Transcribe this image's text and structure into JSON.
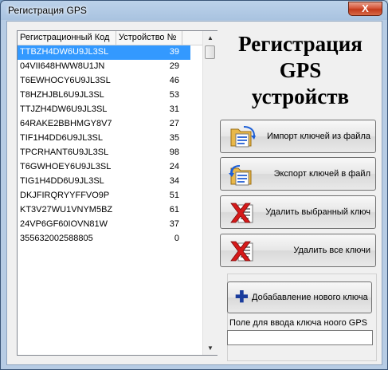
{
  "window": {
    "title": "Регистрация GPS",
    "close_label": "X"
  },
  "table": {
    "columns": [
      "Регистрационный Код",
      "Устройство №"
    ],
    "rows": [
      {
        "code": "TTBZH4DW6U9JL3SL",
        "device": "39",
        "selected": true
      },
      {
        "code": "04VII648HWW8U1JN",
        "device": "29"
      },
      {
        "code": "T6EWHOCY6U9JL3SL",
        "device": "46"
      },
      {
        "code": "T8HZHJBL6U9JL3SL",
        "device": "53"
      },
      {
        "code": "TTJZH4DW6U9JL3SL",
        "device": "31"
      },
      {
        "code": "64RAKE2BBHMGY8V7",
        "device": "27"
      },
      {
        "code": "TIF1H4DD6U9JL3SL",
        "device": "35"
      },
      {
        "code": "TPCRHANT6U9JL3SL",
        "device": "98"
      },
      {
        "code": "T6GWHOEY6U9JL3SL",
        "device": "24"
      },
      {
        "code": "TIG1H4DD6U9JL3SL",
        "device": "34"
      },
      {
        "code": "DKJFIRQRYYFFVO9P",
        "device": "51"
      },
      {
        "code": "KT3V27WU1VNYM5BZ",
        "device": "61"
      },
      {
        "code": "24VP6GF60IOVN81W",
        "device": "37"
      },
      {
        "code": "355632002588805",
        "device": "0"
      }
    ]
  },
  "heading": {
    "line1": "Регистрация",
    "line2": "GPS",
    "line3": "устройств"
  },
  "buttons": {
    "import": "Импорт ключей из файла",
    "export": "Экспорт ключей в файл",
    "delete_selected": "Удалить выбранный ключ",
    "delete_all": "Удалить все ключи",
    "add_key": "Добабавление нового ключа"
  },
  "key_input": {
    "label": "Поле для ввода ключа ноого GPS",
    "value": ""
  },
  "icons": {
    "import": "folder-import-icon",
    "export": "folder-export-icon",
    "delete": "red-x-delete-icon",
    "add": "plus-icon"
  }
}
